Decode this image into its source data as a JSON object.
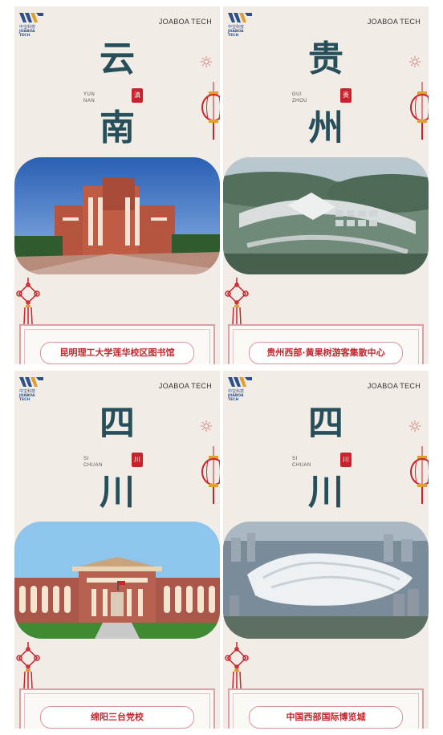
{
  "brand": {
    "logo_cn": "中宝科技",
    "logo_en": "JOABOA TECH",
    "name": "JOABOA TECH"
  },
  "cards": [
    {
      "char1": "云",
      "char2": "南",
      "pinyin1": "YUN",
      "pinyin2": "NAN",
      "seal": "滇",
      "caption": "昆明理工大学莲华校区图书馆"
    },
    {
      "char1": "贵",
      "char2": "州",
      "pinyin1": "GUI",
      "pinyin2": "ZHOU",
      "seal": "贵",
      "caption": "贵州西部·黄果树游客集散中心"
    },
    {
      "char1": "四",
      "char2": "川",
      "pinyin1": "SI",
      "pinyin2": "CHUAN",
      "seal": "川",
      "caption": "绵阳三台党校"
    },
    {
      "char1": "四",
      "char2": "川",
      "pinyin1": "SI",
      "pinyin2": "CHUAN",
      "seal": "川",
      "caption": "中国西部国际博览城"
    }
  ],
  "colors": {
    "card_bg": "#f1ede6",
    "char_color": "#264f5b",
    "accent_red": "#c8232c",
    "logo_blue": "#2d4f8a"
  }
}
